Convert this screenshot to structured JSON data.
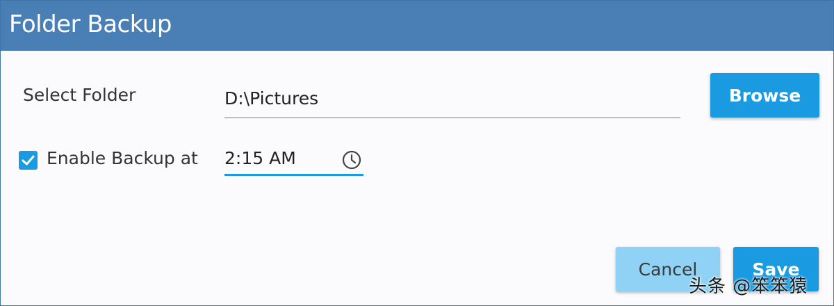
{
  "window": {
    "title": "Folder Backup"
  },
  "folder": {
    "label": "Select Folder",
    "value": "D:\\Pictures",
    "browse_label": "Browse"
  },
  "backup": {
    "enabled": true,
    "label": "Enable Backup at",
    "time": "2:15 AM",
    "time_icon": "clock-icon"
  },
  "actions": {
    "cancel_label": "Cancel",
    "save_label": "Save"
  },
  "watermark": "头条 @笨笨猿",
  "colors": {
    "titlebar": "#4a7fb5",
    "accent": "#1a9ae0",
    "cancel_bg": "#8fd2f5"
  }
}
